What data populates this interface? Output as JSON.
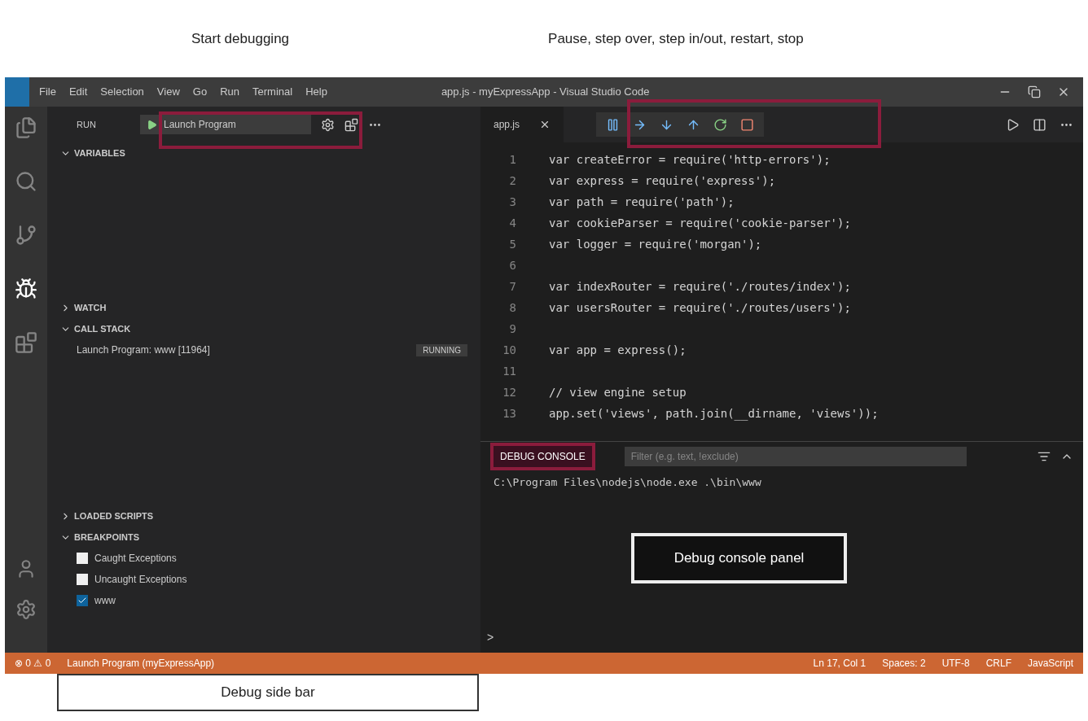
{
  "annotations": {
    "start_debugging": "Start debugging",
    "toolbar": "Pause, step over, step in/out, restart, stop",
    "console_panel": "Debug console panel",
    "side_bar": "Debug side bar"
  },
  "window": {
    "title": "app.js - myExpressApp - Visual Studio Code",
    "menu": [
      "File",
      "Edit",
      "Selection",
      "View",
      "Go",
      "Run",
      "Terminal",
      "Help"
    ]
  },
  "activity_bar": [
    {
      "kind": "files",
      "selected": false
    },
    {
      "kind": "search",
      "selected": false
    },
    {
      "kind": "git",
      "selected": false
    },
    {
      "kind": "debug",
      "selected": true
    },
    {
      "kind": "extensions",
      "selected": false
    }
  ],
  "sidebar": {
    "title": "RUN",
    "launch": "Launch Program",
    "sections": [
      {
        "title": "VARIABLES",
        "expanded": true
      },
      {
        "title": "WATCH",
        "expanded": false
      },
      {
        "title": "CALL STACK",
        "expanded": true,
        "items": [
          {
            "label": "Launch Program: www [11964]",
            "badge": "RUNNING"
          }
        ]
      },
      {
        "title": "LOADED SCRIPTS",
        "expanded": false
      },
      {
        "title": "BREAKPOINTS",
        "expanded": true,
        "items": [
          {
            "label": "Caught Exceptions",
            "checked": false
          },
          {
            "label": "Uncaught Exceptions",
            "checked": false
          },
          {
            "label": "www",
            "checked": true
          }
        ]
      }
    ]
  },
  "editor": {
    "tab": "app.js",
    "lines": [
      {
        "number": "1",
        "code": "var createError = require('http-errors');"
      },
      {
        "number": "2",
        "code": "var express = require('express');"
      },
      {
        "number": "3",
        "code": "var path = require('path');"
      },
      {
        "number": "4",
        "code": "var cookieParser = require('cookie-parser');"
      },
      {
        "number": "5",
        "code": "var logger = require('morgan');"
      },
      {
        "number": "6"
      },
      {
        "number": "7",
        "code": "var indexRouter = require('./routes/index');"
      },
      {
        "number": "8",
        "code": "var usersRouter = require('./routes/users');"
      },
      {
        "number": "9"
      },
      {
        "number": "10",
        "code": "var app = express();"
      },
      {
        "number": "11"
      },
      {
        "number": "12",
        "code": "// view engine setup"
      },
      {
        "number": "13",
        "code": "app.set('views', path.join(__dirname, 'views'));"
      }
    ]
  },
  "panel": {
    "tab": "DEBUG CONSOLE",
    "filter_placeholder": "Filter (e.g. text, !exclude)",
    "output": "C:\\Program Files\\nodejs\\node.exe .\\bin\\www",
    "prompt": ">"
  },
  "status_bar": {
    "left": [
      "⊗ 0  ⚠ 0",
      "Launch Program (myExpressApp)"
    ],
    "right": [
      "Ln 17, Col 1",
      "Spaces: 2",
      "UTF-8",
      "CRLF",
      "JavaScript"
    ]
  }
}
